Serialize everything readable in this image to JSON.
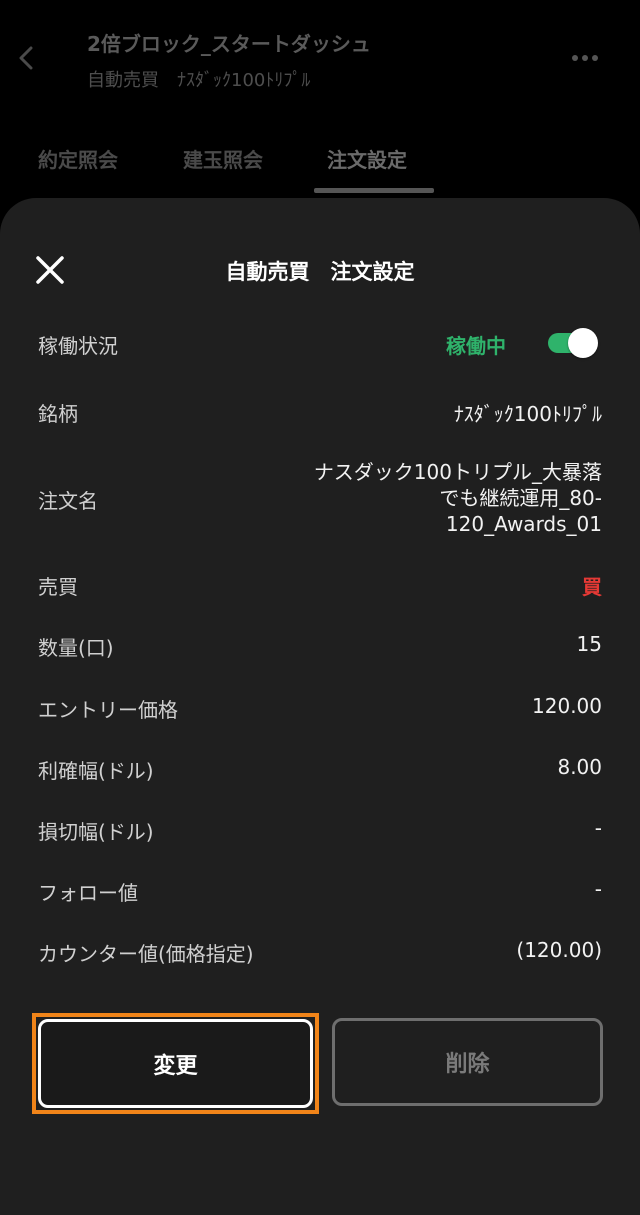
{
  "header": {
    "title": "2倍ブロック_スタートダッシュ",
    "subtitle": "自動売買　ﾅｽﾀﾞｯｸ100ﾄﾘﾌﾟﾙ"
  },
  "tabs": [
    {
      "label": "約定照会"
    },
    {
      "label": "建玉照会"
    },
    {
      "label": "注文設定"
    }
  ],
  "sheet": {
    "title": "自動売買　注文設定",
    "rows": {
      "status": {
        "label": "稼働状況",
        "value": "稼働中",
        "enabled": true
      },
      "symbol": {
        "label": "銘柄",
        "value": "ﾅｽﾀﾞｯｸ100ﾄﾘﾌﾟﾙ"
      },
      "order_name": {
        "label": "注文名",
        "value": "ナスダック100トリプル_大暴落でも継続運用_80-120_Awards_01"
      },
      "side": {
        "label": "売買",
        "value": "買"
      },
      "quantity": {
        "label": "数量(口)",
        "value": "15"
      },
      "entry_price": {
        "label": "エントリー価格",
        "value": "120.00"
      },
      "take_profit": {
        "label": "利確幅(ドル)",
        "value": "8.00"
      },
      "stop_loss": {
        "label": "損切幅(ドル)",
        "value": "-"
      },
      "follow": {
        "label": "フォロー値",
        "value": "-"
      },
      "counter": {
        "label": "カウンター値(価格指定)",
        "value": "(120.00)"
      }
    },
    "buttons": {
      "change": "変更",
      "delete": "削除"
    }
  },
  "colors": {
    "active_green": "#2fb36b",
    "buy_red": "#e53935",
    "highlight_orange": "#f08419"
  }
}
